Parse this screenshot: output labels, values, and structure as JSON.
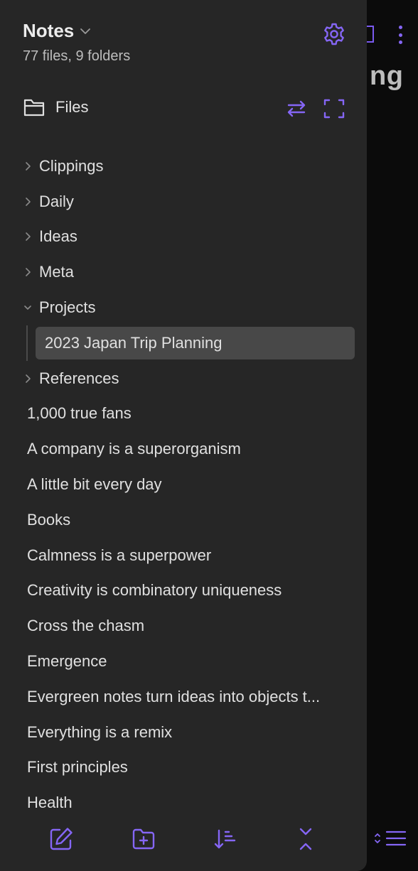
{
  "background": {
    "title_fragment": "ng"
  },
  "sidebar": {
    "vault_name": "Notes",
    "vault_summary": "77 files, 9 folders",
    "section_label": "Files",
    "folders_top": [
      {
        "label": "Clippings",
        "expanded": false
      },
      {
        "label": "Daily",
        "expanded": false
      },
      {
        "label": "Ideas",
        "expanded": false
      },
      {
        "label": "Meta",
        "expanded": false
      },
      {
        "label": "Projects",
        "expanded": true
      }
    ],
    "projects_children": [
      {
        "label": "2023 Japan Trip Planning",
        "selected": true
      }
    ],
    "folders_after": [
      {
        "label": "References",
        "expanded": false
      }
    ],
    "files": [
      {
        "label": "1,000 true fans"
      },
      {
        "label": "A company is a superorganism"
      },
      {
        "label": "A little bit every day"
      },
      {
        "label": "Books"
      },
      {
        "label": "Calmness is a superpower"
      },
      {
        "label": "Creativity is combinatory uniqueness"
      },
      {
        "label": "Cross the chasm"
      },
      {
        "label": "Emergence"
      },
      {
        "label": "Evergreen notes turn ideas into objects t..."
      },
      {
        "label": "Everything is a remix"
      },
      {
        "label": "First principles"
      },
      {
        "label": "Health"
      }
    ]
  },
  "icons": {
    "vault_menu": "chevron-down-icon",
    "settings": "gear-icon",
    "section": "folder-icon",
    "reveal": "swap-arrows-icon",
    "focus": "expand-corners-icon",
    "new_note": "new-note-icon",
    "new_folder": "new-folder-icon",
    "sort": "sort-icon",
    "collapse": "collapse-all-icon"
  },
  "colors": {
    "accent": "#8566f5",
    "panel": "#262626",
    "selected": "#484848",
    "text": "#e0e0e0"
  }
}
